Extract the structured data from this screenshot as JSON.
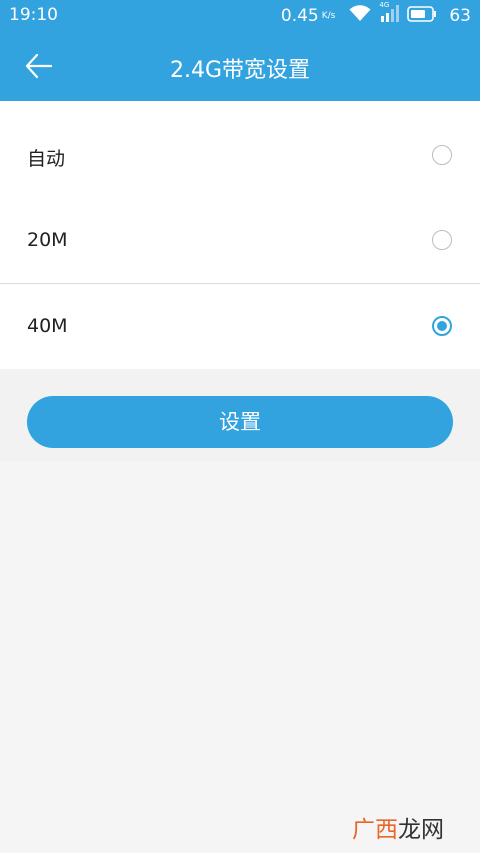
{
  "status_bar": {
    "time": "19:10",
    "speed": "0.45",
    "speed_unit": "K/s",
    "network_type": "4G",
    "battery": "63",
    "icons": [
      "wifi-icon",
      "signal-icon",
      "battery-icon"
    ]
  },
  "app_bar": {
    "title": "2.4G带宽设置",
    "back_icon": "arrow-left-icon"
  },
  "options": [
    {
      "label": "自动",
      "selected": false
    },
    {
      "label": "20M",
      "selected": false
    },
    {
      "label": "40M",
      "selected": true
    }
  ],
  "submit_button": {
    "label": "设置"
  },
  "watermark": {
    "part1": "广西",
    "part2": "龙网"
  },
  "colors": {
    "primary": "#33a3e0",
    "background": "#f5f5f5",
    "watermark_accent": "#e8672a"
  }
}
